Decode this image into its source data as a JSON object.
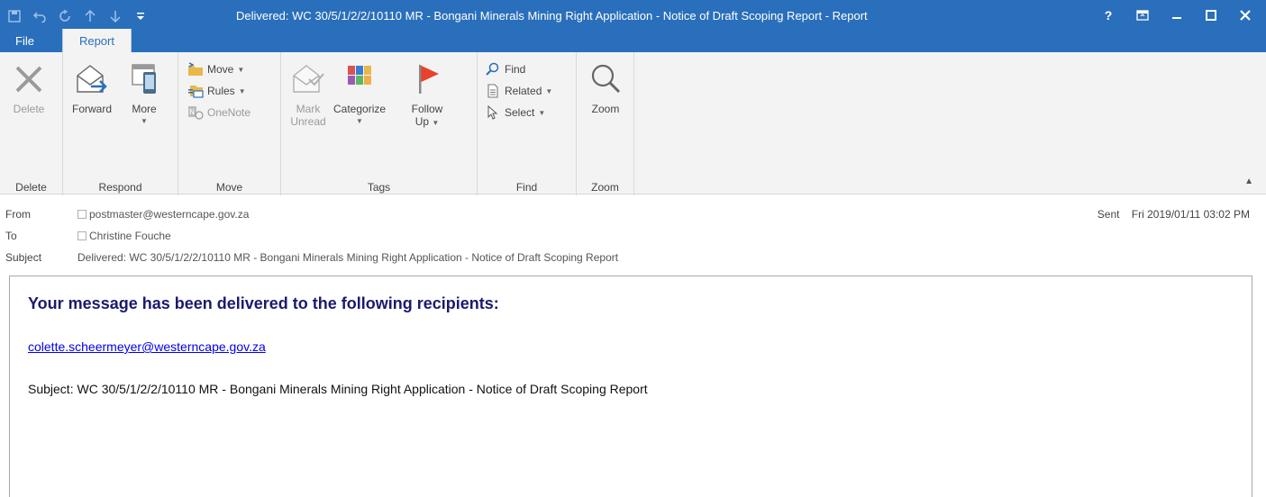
{
  "window": {
    "title": "Delivered: WC 30/5/1/2/2/10110 MR - Bongani Minerals Mining Right Application - Notice of Draft Scoping Report - Report",
    "help_label": "?",
    "quick_access": [
      "save-icon",
      "undo-icon",
      "redo-icon",
      "up-arrow-icon",
      "down-arrow-icon",
      "customize-qat-icon"
    ],
    "controls": [
      "ribbon-display-options-icon",
      "minimize-icon",
      "maximize-icon",
      "close-icon"
    ]
  },
  "tabs": [
    {
      "label": "File"
    },
    {
      "label": "Report"
    }
  ],
  "ribbon": {
    "delete_group": {
      "label": "Delete",
      "delete_button": "Delete"
    },
    "respond_group": {
      "label": "Respond",
      "forward_button": "Forward",
      "more_button": "More"
    },
    "move_group": {
      "label": "Move",
      "move_button": "Move",
      "rules_button": "Rules",
      "onenote_button": "OneNote"
    },
    "tags_group": {
      "label": "Tags",
      "mark_unread_line1": "Mark",
      "mark_unread_line2": "Unread",
      "categorize_button": "Categorize",
      "follow_up_line1": "Follow",
      "follow_up_line2": "Up"
    },
    "find_group": {
      "label": "Find",
      "find_button": "Find",
      "related_button": "Related",
      "select_button": "Select"
    },
    "zoom_group": {
      "label": "Zoom",
      "zoom_button": "Zoom"
    }
  },
  "header": {
    "from_label": "From",
    "from_value": "postmaster@westerncape.gov.za",
    "to_label": "To",
    "to_value": "Christine Fouche",
    "subject_label": "Subject",
    "subject_value": "Delivered: WC 30/5/1/2/2/10110 MR - Bongani Minerals Mining Right Application - Notice of Draft Scoping Report",
    "sent_label": "Sent",
    "sent_value": "Fri 2019/01/11 03:02 PM"
  },
  "message": {
    "heading": "Your message has been delivered to the following recipients:",
    "recipient": "colette.scheermeyer@westerncape.gov.za",
    "subject_line": "Subject: WC 30/5/1/2/2/10110 MR - Bongani Minerals Mining Right Application - Notice of Draft Scoping Report"
  },
  "colors": {
    "titlebar": "#2a6fbb",
    "ribbon_bg": "#f3f3f3",
    "heading": "#1a1a6e",
    "link": "#0000ee"
  }
}
